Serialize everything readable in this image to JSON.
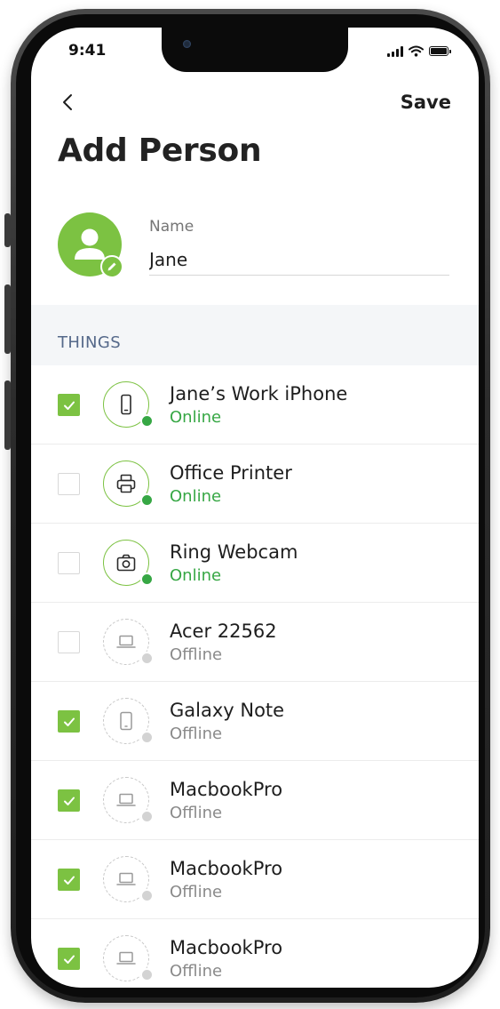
{
  "status_bar": {
    "time": "9:41"
  },
  "header": {
    "save_label": "Save",
    "title": "Add Person"
  },
  "person": {
    "name_label": "Name",
    "name_value": "Jane"
  },
  "section": {
    "title": "THINGS"
  },
  "colors": {
    "accent": "#7cc242",
    "online": "#36a744",
    "offline": "#8a8a8a"
  },
  "devices": [
    {
      "name": "Jane’s Work iPhone",
      "status": "Online",
      "icon": "phone-icon",
      "checked": true
    },
    {
      "name": "Office Printer",
      "status": "Online",
      "icon": "printer-icon",
      "checked": false
    },
    {
      "name": "Ring Webcam",
      "status": "Online",
      "icon": "camera-icon",
      "checked": false
    },
    {
      "name": "Acer 22562",
      "status": "Offline",
      "icon": "laptop-icon",
      "checked": false
    },
    {
      "name": "Galaxy Note",
      "status": "Offline",
      "icon": "tablet-icon",
      "checked": true
    },
    {
      "name": "MacbookPro",
      "status": "Offline",
      "icon": "laptop-icon",
      "checked": true
    },
    {
      "name": "MacbookPro",
      "status": "Offline",
      "icon": "laptop-icon",
      "checked": true
    },
    {
      "name": "MacbookPro",
      "status": "Offline",
      "icon": "laptop-icon",
      "checked": true
    }
  ]
}
